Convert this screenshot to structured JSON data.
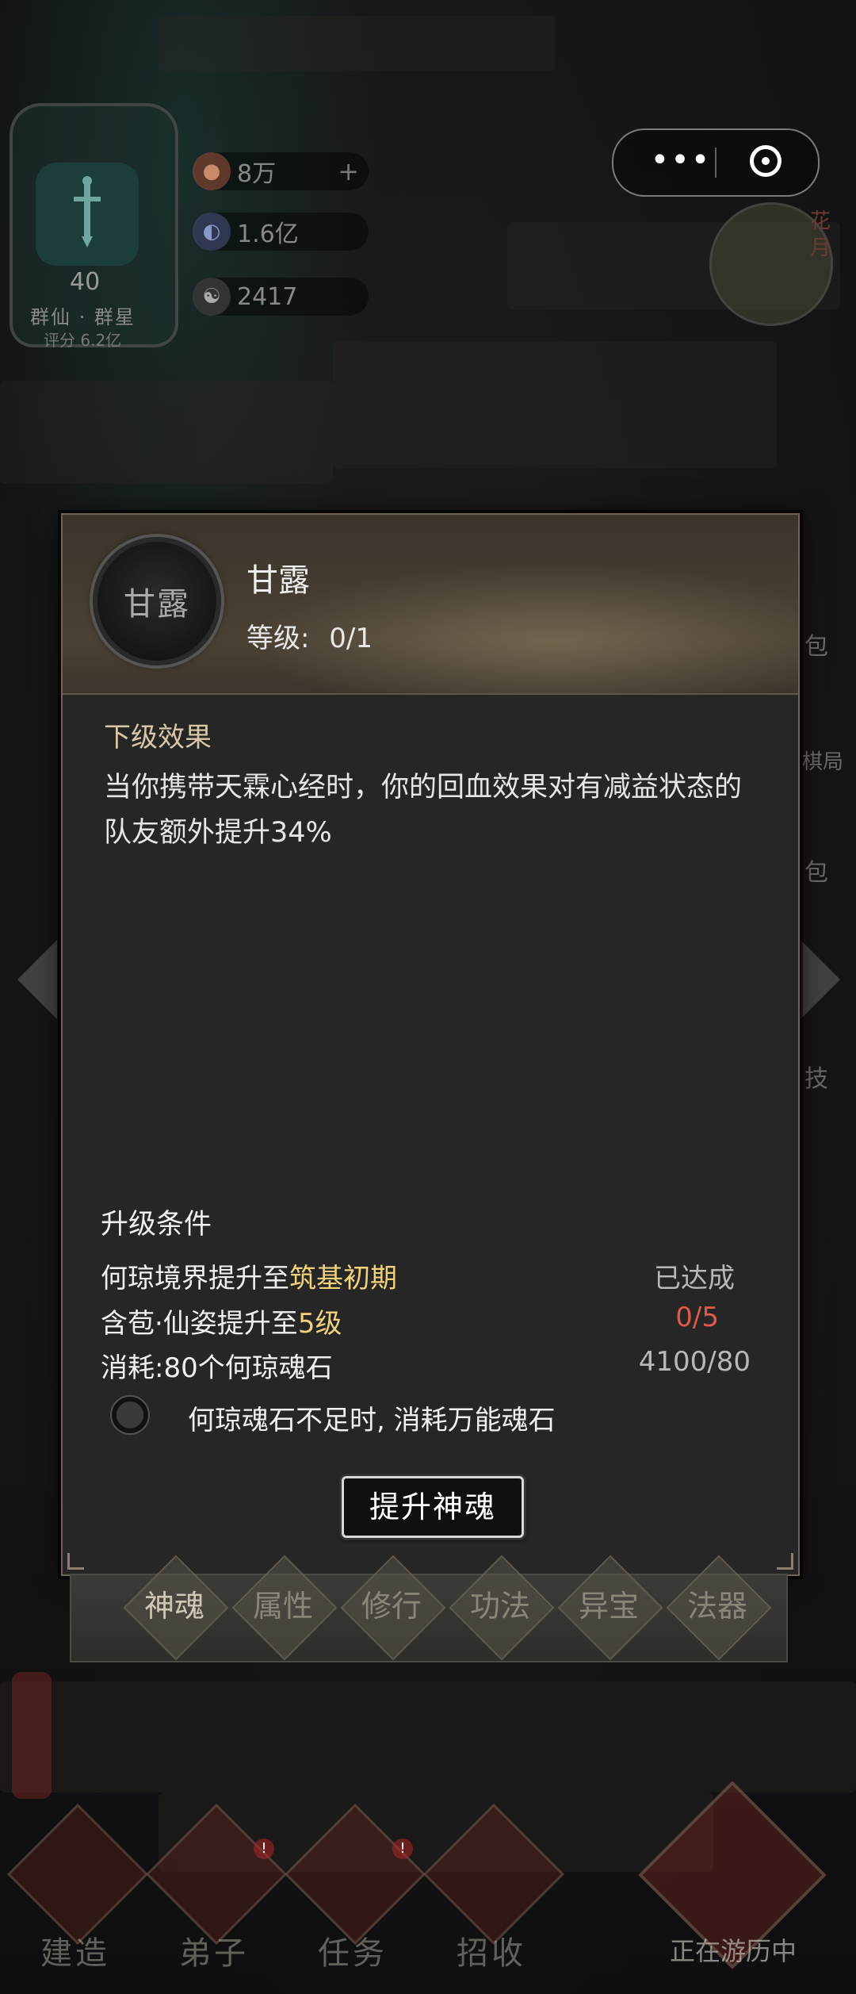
{
  "header": {
    "level": "40",
    "guild": "群仙 · 群星",
    "score": "评分 6.2亿",
    "resources": [
      {
        "icon": "peach-icon",
        "value": "8万",
        "has_plus": true
      },
      {
        "icon": "orb-icon",
        "value": "1.6亿",
        "has_plus": false
      },
      {
        "icon": "yinyang-icon",
        "value": "2417",
        "has_plus": false
      }
    ],
    "menu_more": "•••",
    "clock_label": "花月"
  },
  "dialog": {
    "icon_text": "甘露",
    "skill_name": "甘露",
    "level_label": "等级:",
    "level_value": "0/1",
    "effect_title": "下级效果",
    "effect_text": "当你携带天霖心经时，你的回血效果对有减益状态的队友额外提升34%",
    "upgrade_title": "升级条件",
    "conditions": [
      {
        "prefix": "何琼境界提升至",
        "highlight": "筑基初期",
        "status": "已达成",
        "status_type": "ok"
      },
      {
        "prefix": "含苞·仙姿提升至",
        "highlight": "5级",
        "status": "0/5",
        "status_type": "bad"
      },
      {
        "prefix": "消耗:80个何琼魂石",
        "highlight": "",
        "status": "4100/80",
        "status_type": "gray"
      }
    ],
    "toggle_label": "何琼魂石不足时, 消耗万能魂石",
    "upgrade_button": "提升神魂"
  },
  "tabs": [
    {
      "label": "神魂",
      "active": true
    },
    {
      "label": "属性",
      "active": false
    },
    {
      "label": "修行",
      "active": false
    },
    {
      "label": "功法",
      "active": false
    },
    {
      "label": "异宝",
      "active": false
    },
    {
      "label": "法器",
      "active": false
    }
  ],
  "side_right": [
    "包",
    "棋局",
    "包",
    "技"
  ],
  "bottom_nav": [
    {
      "label": "建造",
      "badge": ""
    },
    {
      "label": "弟子",
      "badge": "!"
    },
    {
      "label": "任务",
      "badge": "!"
    },
    {
      "label": "招收",
      "badge": ""
    }
  ],
  "travel_label": "正在游历中",
  "colors": {
    "highlight": "#f2d27a",
    "fail": "#e05a47",
    "panel": "#262626"
  }
}
